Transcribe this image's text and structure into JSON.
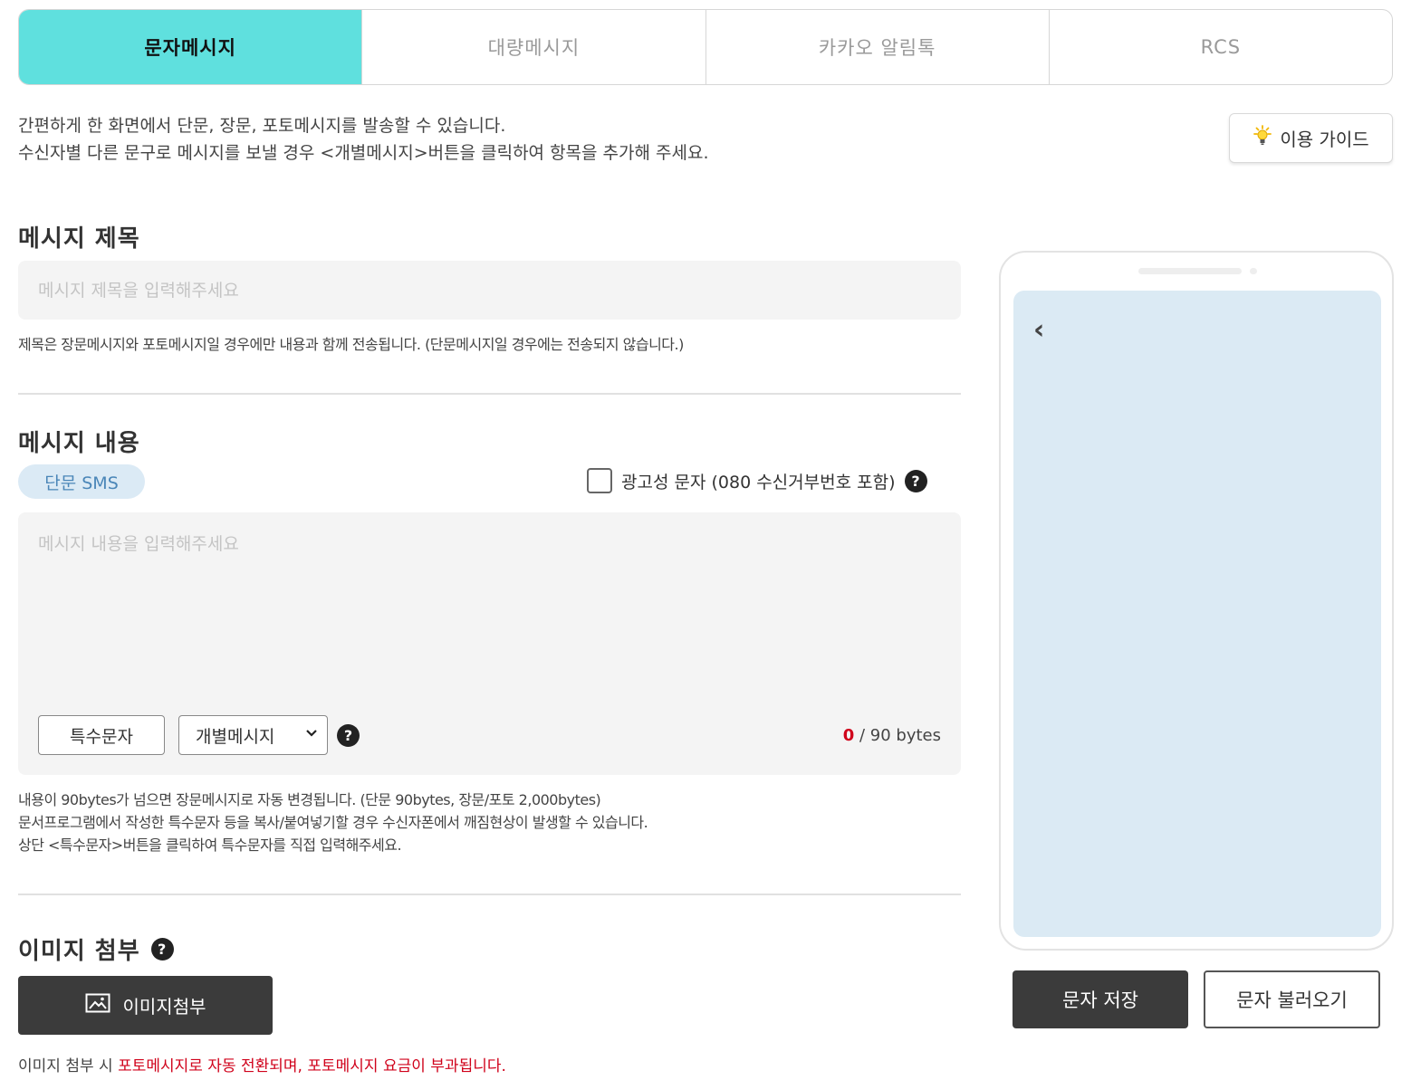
{
  "tabs": [
    {
      "label": "문자메시지",
      "active": true
    },
    {
      "label": "대량메시지",
      "active": false
    },
    {
      "label": "카카오 알림톡",
      "active": false
    },
    {
      "label": "RCS",
      "active": false
    }
  ],
  "intro": {
    "line1": "간편하게 한 화면에서 단문, 장문, 포토메시지를 발송할 수 있습니다.",
    "line2": "수신자별 다른 문구로 메시지를 보낼 경우 <개별메시지>버튼을 클릭하여 항목을 추가해 주세요."
  },
  "guide_button": {
    "label": "이용 가이드",
    "icon": "lightbulb-icon"
  },
  "message_title": {
    "heading": "메시지 제목",
    "placeholder": "메시지 제목을 입력해주세요",
    "value": "",
    "note": "제목은 장문메시지와 포토메시지일 경우에만 내용과 함께 전송됩니다. (단문메시지일 경우에는 전송되지 않습니다.)"
  },
  "message_content": {
    "heading": "메시지 내용",
    "type_badge": "단문 SMS",
    "ad_checkbox_label": "광고성 문자 (080 수신거부번호 포함)",
    "ad_checked": false,
    "placeholder": "메시지 내용을 입력해주세요",
    "value": "",
    "special_char_button": "특수문자",
    "individual_select": "개별메시지",
    "byte_current": "0",
    "byte_limit": " / 90 bytes",
    "notes": [
      "내용이 90bytes가 넘으면 장문메시지로 자동 변경됩니다. (단문 90bytes, 장문/포토 2,000bytes)",
      "문서프로그램에서 작성한 특수문자 등을 복사/붙여넣기할 경우 수신자폰에서 깨짐현상이 발생할 수 있습니다.",
      "상단 <특수문자>버튼을 클릭하여 특수문자를 직접 입력해주세요."
    ]
  },
  "image_attach": {
    "heading": "이미지 첨부",
    "button_label": "이미지첨부",
    "note_prefix": "이미지 첨부 시 ",
    "note_highlight": "포토메시지로 자동 전환되며, 포토메시지 요금이 부과됩니다."
  },
  "help_glyph": "?",
  "preview": {
    "back_glyph": "‹"
  },
  "actions": {
    "save": "문자 저장",
    "load": "문자 불러오기"
  },
  "colors": {
    "active_tab": "#5fe0de",
    "badge_bg": "#dbeaf5",
    "badge_text": "#4a86b8",
    "preview_screen": "#dbeaf4",
    "dark_button": "#3b3b3b",
    "warning_red": "#d0021b"
  }
}
